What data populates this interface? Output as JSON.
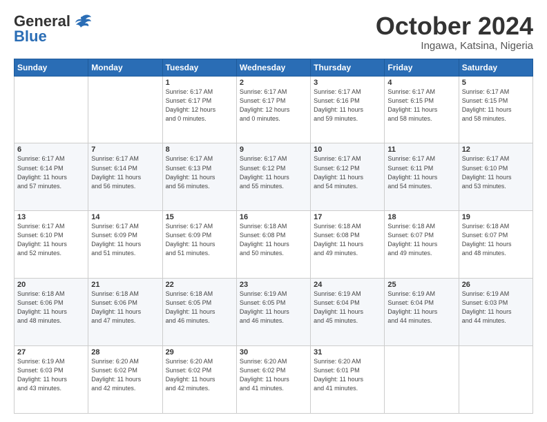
{
  "header": {
    "logo_general": "General",
    "logo_blue": "Blue",
    "title": "October 2024",
    "subtitle": "Ingawa, Katsina, Nigeria"
  },
  "weekdays": [
    "Sunday",
    "Monday",
    "Tuesday",
    "Wednesday",
    "Thursday",
    "Friday",
    "Saturday"
  ],
  "weeks": [
    [
      {
        "day": "",
        "info": ""
      },
      {
        "day": "",
        "info": ""
      },
      {
        "day": "1",
        "info": "Sunrise: 6:17 AM\nSunset: 6:17 PM\nDaylight: 12 hours\nand 0 minutes."
      },
      {
        "day": "2",
        "info": "Sunrise: 6:17 AM\nSunset: 6:17 PM\nDaylight: 12 hours\nand 0 minutes."
      },
      {
        "day": "3",
        "info": "Sunrise: 6:17 AM\nSunset: 6:16 PM\nDaylight: 11 hours\nand 59 minutes."
      },
      {
        "day": "4",
        "info": "Sunrise: 6:17 AM\nSunset: 6:15 PM\nDaylight: 11 hours\nand 58 minutes."
      },
      {
        "day": "5",
        "info": "Sunrise: 6:17 AM\nSunset: 6:15 PM\nDaylight: 11 hours\nand 58 minutes."
      }
    ],
    [
      {
        "day": "6",
        "info": "Sunrise: 6:17 AM\nSunset: 6:14 PM\nDaylight: 11 hours\nand 57 minutes."
      },
      {
        "day": "7",
        "info": "Sunrise: 6:17 AM\nSunset: 6:14 PM\nDaylight: 11 hours\nand 56 minutes."
      },
      {
        "day": "8",
        "info": "Sunrise: 6:17 AM\nSunset: 6:13 PM\nDaylight: 11 hours\nand 56 minutes."
      },
      {
        "day": "9",
        "info": "Sunrise: 6:17 AM\nSunset: 6:12 PM\nDaylight: 11 hours\nand 55 minutes."
      },
      {
        "day": "10",
        "info": "Sunrise: 6:17 AM\nSunset: 6:12 PM\nDaylight: 11 hours\nand 54 minutes."
      },
      {
        "day": "11",
        "info": "Sunrise: 6:17 AM\nSunset: 6:11 PM\nDaylight: 11 hours\nand 54 minutes."
      },
      {
        "day": "12",
        "info": "Sunrise: 6:17 AM\nSunset: 6:10 PM\nDaylight: 11 hours\nand 53 minutes."
      }
    ],
    [
      {
        "day": "13",
        "info": "Sunrise: 6:17 AM\nSunset: 6:10 PM\nDaylight: 11 hours\nand 52 minutes."
      },
      {
        "day": "14",
        "info": "Sunrise: 6:17 AM\nSunset: 6:09 PM\nDaylight: 11 hours\nand 51 minutes."
      },
      {
        "day": "15",
        "info": "Sunrise: 6:17 AM\nSunset: 6:09 PM\nDaylight: 11 hours\nand 51 minutes."
      },
      {
        "day": "16",
        "info": "Sunrise: 6:18 AM\nSunset: 6:08 PM\nDaylight: 11 hours\nand 50 minutes."
      },
      {
        "day": "17",
        "info": "Sunrise: 6:18 AM\nSunset: 6:08 PM\nDaylight: 11 hours\nand 49 minutes."
      },
      {
        "day": "18",
        "info": "Sunrise: 6:18 AM\nSunset: 6:07 PM\nDaylight: 11 hours\nand 49 minutes."
      },
      {
        "day": "19",
        "info": "Sunrise: 6:18 AM\nSunset: 6:07 PM\nDaylight: 11 hours\nand 48 minutes."
      }
    ],
    [
      {
        "day": "20",
        "info": "Sunrise: 6:18 AM\nSunset: 6:06 PM\nDaylight: 11 hours\nand 48 minutes."
      },
      {
        "day": "21",
        "info": "Sunrise: 6:18 AM\nSunset: 6:06 PM\nDaylight: 11 hours\nand 47 minutes."
      },
      {
        "day": "22",
        "info": "Sunrise: 6:18 AM\nSunset: 6:05 PM\nDaylight: 11 hours\nand 46 minutes."
      },
      {
        "day": "23",
        "info": "Sunrise: 6:19 AM\nSunset: 6:05 PM\nDaylight: 11 hours\nand 46 minutes."
      },
      {
        "day": "24",
        "info": "Sunrise: 6:19 AM\nSunset: 6:04 PM\nDaylight: 11 hours\nand 45 minutes."
      },
      {
        "day": "25",
        "info": "Sunrise: 6:19 AM\nSunset: 6:04 PM\nDaylight: 11 hours\nand 44 minutes."
      },
      {
        "day": "26",
        "info": "Sunrise: 6:19 AM\nSunset: 6:03 PM\nDaylight: 11 hours\nand 44 minutes."
      }
    ],
    [
      {
        "day": "27",
        "info": "Sunrise: 6:19 AM\nSunset: 6:03 PM\nDaylight: 11 hours\nand 43 minutes."
      },
      {
        "day": "28",
        "info": "Sunrise: 6:20 AM\nSunset: 6:02 PM\nDaylight: 11 hours\nand 42 minutes."
      },
      {
        "day": "29",
        "info": "Sunrise: 6:20 AM\nSunset: 6:02 PM\nDaylight: 11 hours\nand 42 minutes."
      },
      {
        "day": "30",
        "info": "Sunrise: 6:20 AM\nSunset: 6:02 PM\nDaylight: 11 hours\nand 41 minutes."
      },
      {
        "day": "31",
        "info": "Sunrise: 6:20 AM\nSunset: 6:01 PM\nDaylight: 11 hours\nand 41 minutes."
      },
      {
        "day": "",
        "info": ""
      },
      {
        "day": "",
        "info": ""
      }
    ]
  ]
}
